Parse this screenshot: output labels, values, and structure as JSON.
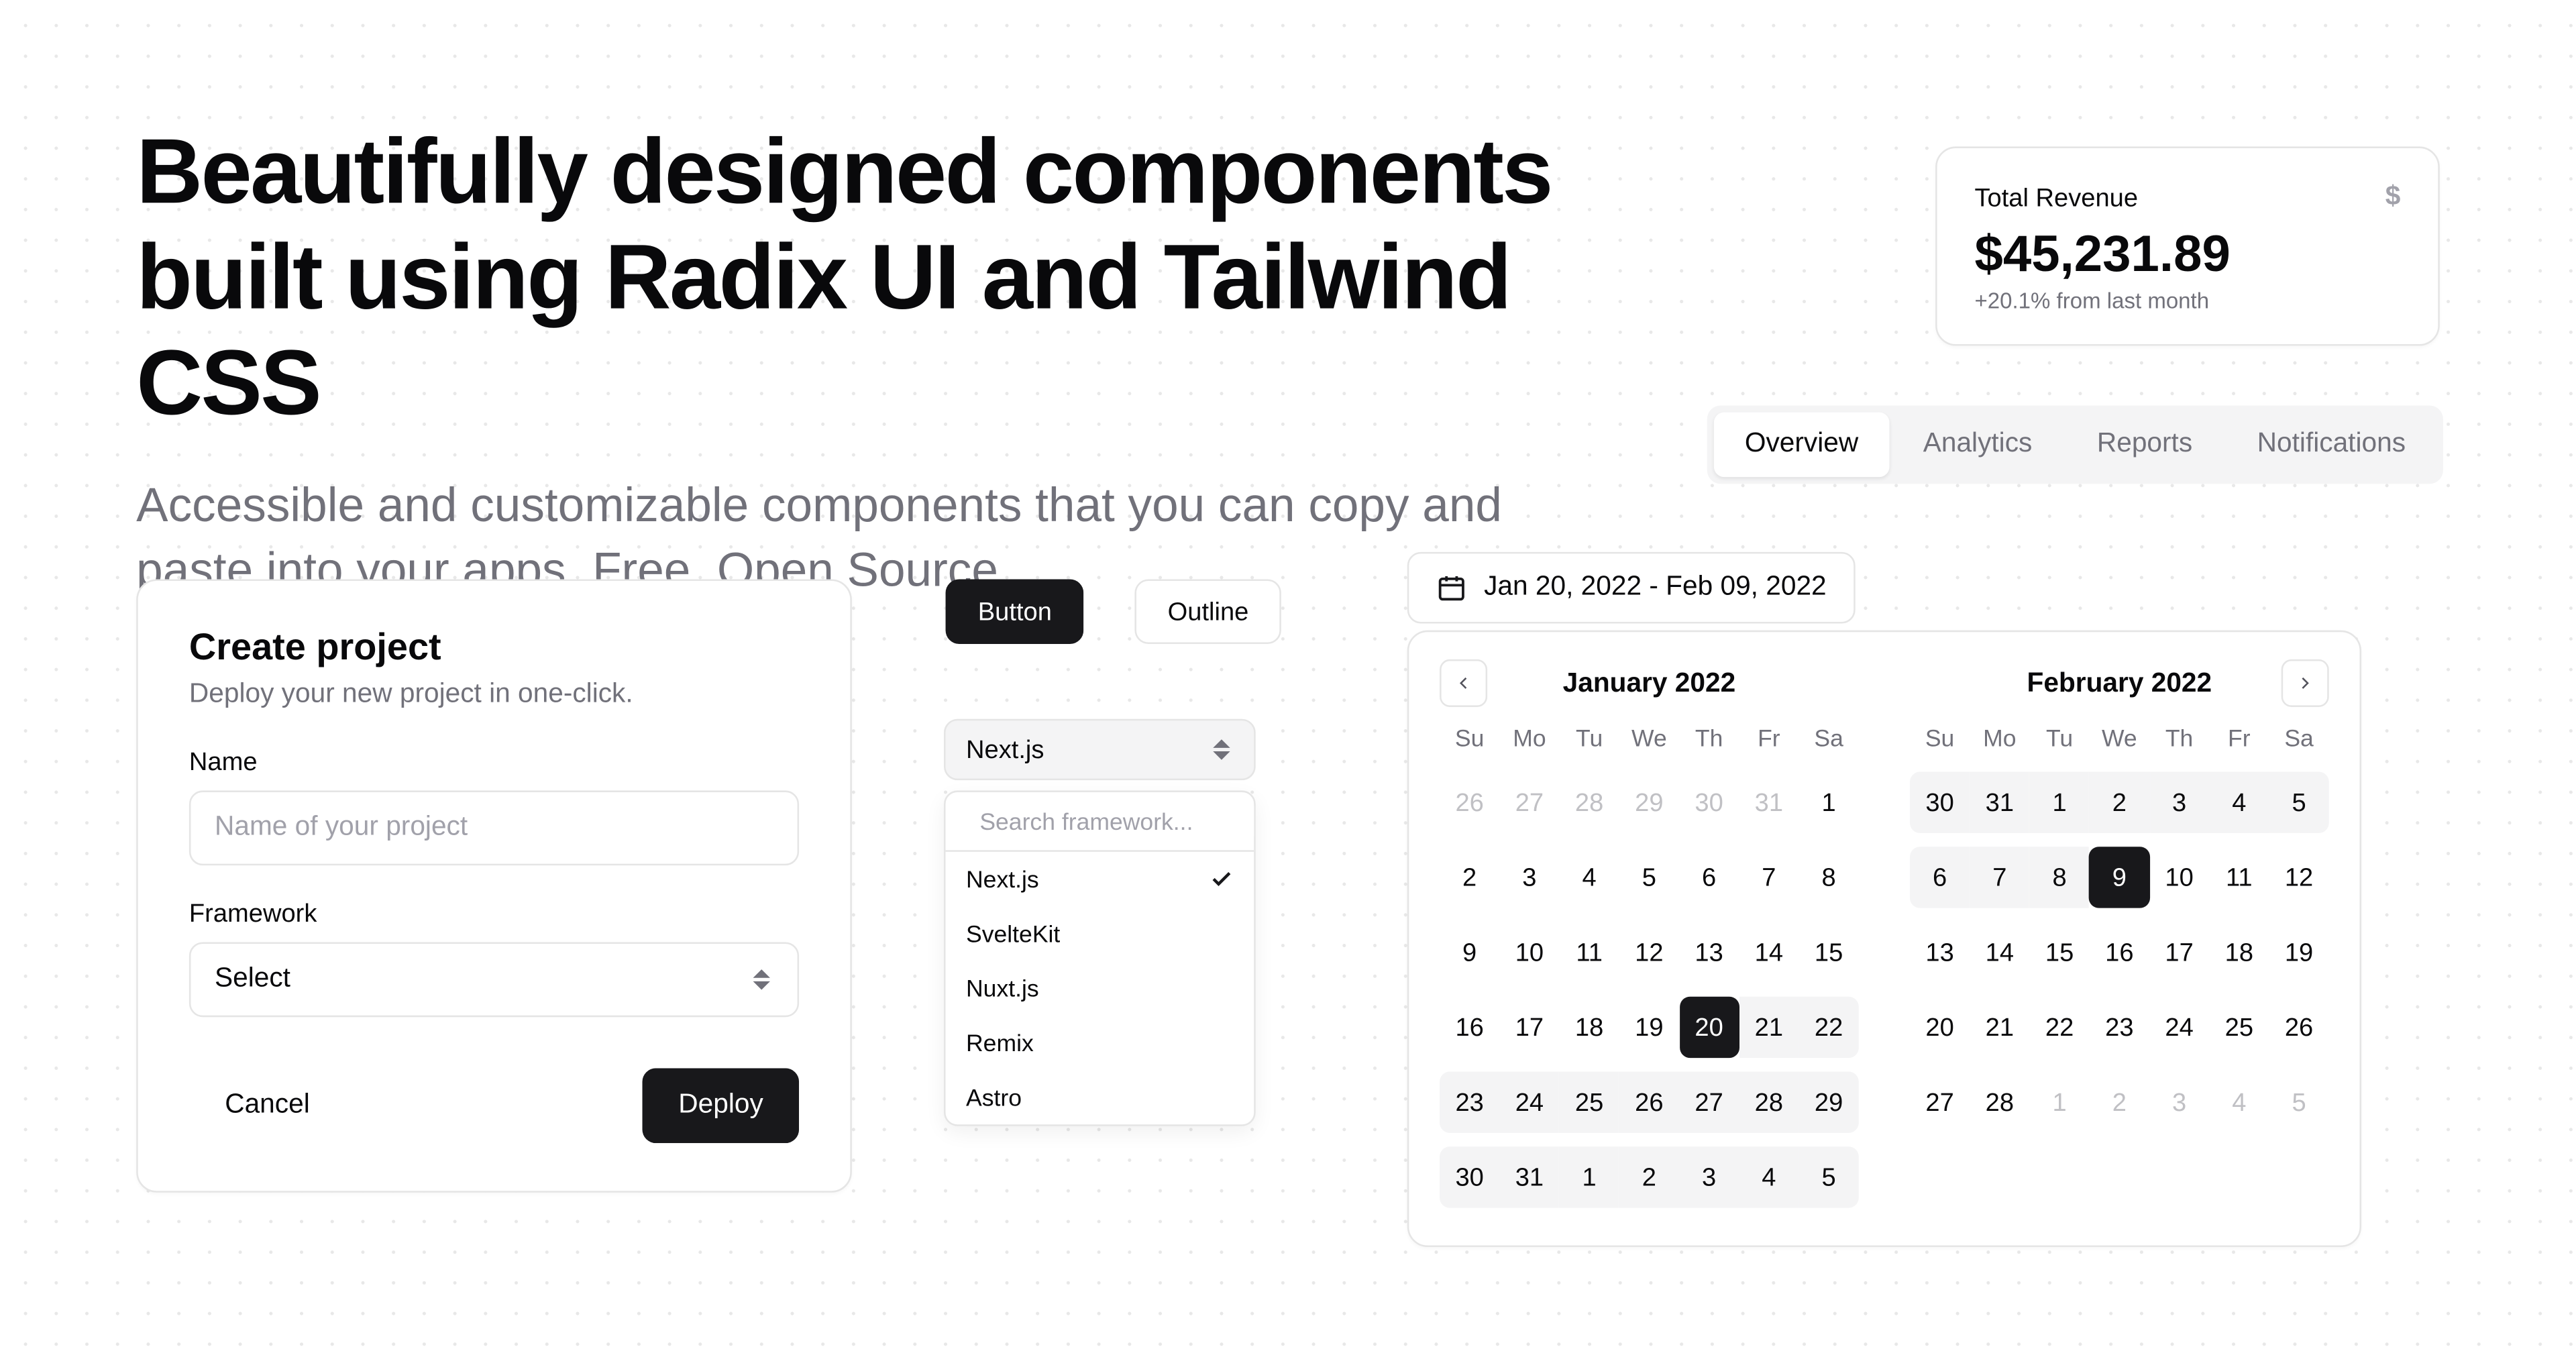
{
  "hero": {
    "title": "Beautifully designed components built using Radix UI and Tailwind CSS",
    "subtitle": "Accessible and customizable components that you can copy and paste into your apps. Free. Open Source."
  },
  "create": {
    "title": "Create project",
    "description": "Deploy your new project in one-click.",
    "name_label": "Name",
    "name_placeholder": "Name of your project",
    "framework_label": "Framework",
    "framework_value": "Select",
    "cancel_label": "Cancel",
    "deploy_label": "Deploy"
  },
  "buttons": {
    "primary_label": "Button",
    "outline_label": "Outline"
  },
  "combobox": {
    "selected": "Next.js",
    "search_placeholder": "Search framework...",
    "options": [
      "Next.js",
      "SvelteKit",
      "Nuxt.js",
      "Remix",
      "Astro"
    ]
  },
  "revenue": {
    "title": "Total Revenue",
    "amount": "$45,231.89",
    "delta": "+20.1% from last month"
  },
  "tabs": {
    "items": [
      "Overview",
      "Analytics",
      "Reports",
      "Notifications"
    ],
    "active_index": 0
  },
  "date_range": {
    "display": "Jan 20, 2022 - Feb 09, 2022"
  },
  "calendar": {
    "weekdays": [
      "Su",
      "Mo",
      "Tu",
      "We",
      "Th",
      "Fr",
      "Sa"
    ],
    "months": [
      {
        "label": "January 2022",
        "days": [
          {
            "d": 26,
            "out": true
          },
          {
            "d": 27,
            "out": true
          },
          {
            "d": 28,
            "out": true
          },
          {
            "d": 29,
            "out": true
          },
          {
            "d": 30,
            "out": true
          },
          {
            "d": 31,
            "out": true
          },
          {
            "d": 1
          },
          {
            "d": 2
          },
          {
            "d": 3
          },
          {
            "d": 4
          },
          {
            "d": 5
          },
          {
            "d": 6
          },
          {
            "d": 7
          },
          {
            "d": 8
          },
          {
            "d": 9
          },
          {
            "d": 10
          },
          {
            "d": 11
          },
          {
            "d": 12
          },
          {
            "d": 13
          },
          {
            "d": 14
          },
          {
            "d": 15
          },
          {
            "d": 16
          },
          {
            "d": 17
          },
          {
            "d": 18
          },
          {
            "d": 19
          },
          {
            "d": 20,
            "sel": true,
            "range": true,
            "rl": true
          },
          {
            "d": 21,
            "range": true
          },
          {
            "d": 22,
            "range": true,
            "rr": true
          },
          {
            "d": 23,
            "range": true,
            "rl": true
          },
          {
            "d": 24,
            "range": true
          },
          {
            "d": 25,
            "range": true
          },
          {
            "d": 26,
            "range": true
          },
          {
            "d": 27,
            "range": true
          },
          {
            "d": 28,
            "range": true
          },
          {
            "d": 29,
            "range": true,
            "rr": true
          },
          {
            "d": 30,
            "range": true,
            "rl": true
          },
          {
            "d": 31,
            "range": true
          },
          {
            "d": 1,
            "range": true
          },
          {
            "d": 2,
            "range": true
          },
          {
            "d": 3,
            "range": true
          },
          {
            "d": 4,
            "range": true
          },
          {
            "d": 5,
            "range": true,
            "rr": true
          }
        ]
      },
      {
        "label": "February 2022",
        "days": [
          {
            "d": 30,
            "range": true,
            "rl": true
          },
          {
            "d": 31,
            "range": true
          },
          {
            "d": 1,
            "range": true
          },
          {
            "d": 2,
            "range": true
          },
          {
            "d": 3,
            "range": true
          },
          {
            "d": 4,
            "range": true
          },
          {
            "d": 5,
            "range": true,
            "rr": true
          },
          {
            "d": 6,
            "range": true,
            "rl": true
          },
          {
            "d": 7,
            "range": true
          },
          {
            "d": 8,
            "range": true
          },
          {
            "d": 9,
            "sel": true,
            "range": true,
            "rr": true
          },
          {
            "d": 10
          },
          {
            "d": 11
          },
          {
            "d": 12
          },
          {
            "d": 13
          },
          {
            "d": 14
          },
          {
            "d": 15
          },
          {
            "d": 16
          },
          {
            "d": 17
          },
          {
            "d": 18
          },
          {
            "d": 19
          },
          {
            "d": 20
          },
          {
            "d": 21
          },
          {
            "d": 22
          },
          {
            "d": 23
          },
          {
            "d": 24
          },
          {
            "d": 25
          },
          {
            "d": 26
          },
          {
            "d": 27
          },
          {
            "d": 28
          },
          {
            "d": 1,
            "out": true
          },
          {
            "d": 2,
            "out": true
          },
          {
            "d": 3,
            "out": true
          },
          {
            "d": 4,
            "out": true
          },
          {
            "d": 5,
            "out": true
          }
        ]
      }
    ]
  }
}
